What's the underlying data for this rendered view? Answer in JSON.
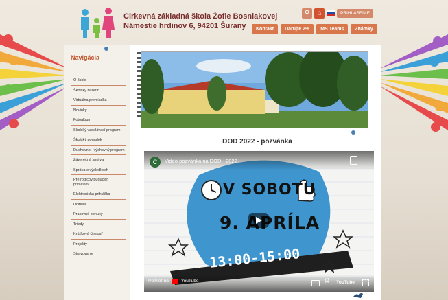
{
  "school": {
    "name": "Cirkevná základná škola Žofie Bosniakovej",
    "address": "Námestie hrdinov 6, 94201 Šurany"
  },
  "topbar": {
    "login_label": "PRIHLÁSENIE"
  },
  "menu": [
    "Kontakt",
    "Darujte 2%",
    "MS Teams",
    "Známky"
  ],
  "nav": {
    "title": "Navigácia",
    "items": [
      "O škole",
      "Školský bulletin",
      "Virtuálna prehliadka",
      "Novinky",
      "Fotoalbum",
      "Školský vzdelávací program",
      "Školský poriadok",
      "Duchovno - výchovný program",
      "Záverečná správa",
      "Správa o výsledkoch",
      "Pre rodičov budúcich prváčikov",
      "Elektronická prihláška",
      "Učitelia",
      "Pracovné ponuky",
      "Triedy",
      "Krúžková činnosť",
      "Projekty",
      "Stravovanie"
    ]
  },
  "post": {
    "title": "DOD 2022 - pozvánka"
  },
  "video": {
    "channel_initial": "C",
    "title": "Video pozvánka na DOD - 2022",
    "poster_line1": "V SOBOTU",
    "poster_line2": "9. APRÍLA",
    "poster_time": "13:00-15:00",
    "watch_on": "Pozrieť na",
    "youtube_label": "YouTube"
  },
  "colors": {
    "accent": "#d8774b",
    "title": "#7a2e2e",
    "nav_title": "#c0572f"
  }
}
